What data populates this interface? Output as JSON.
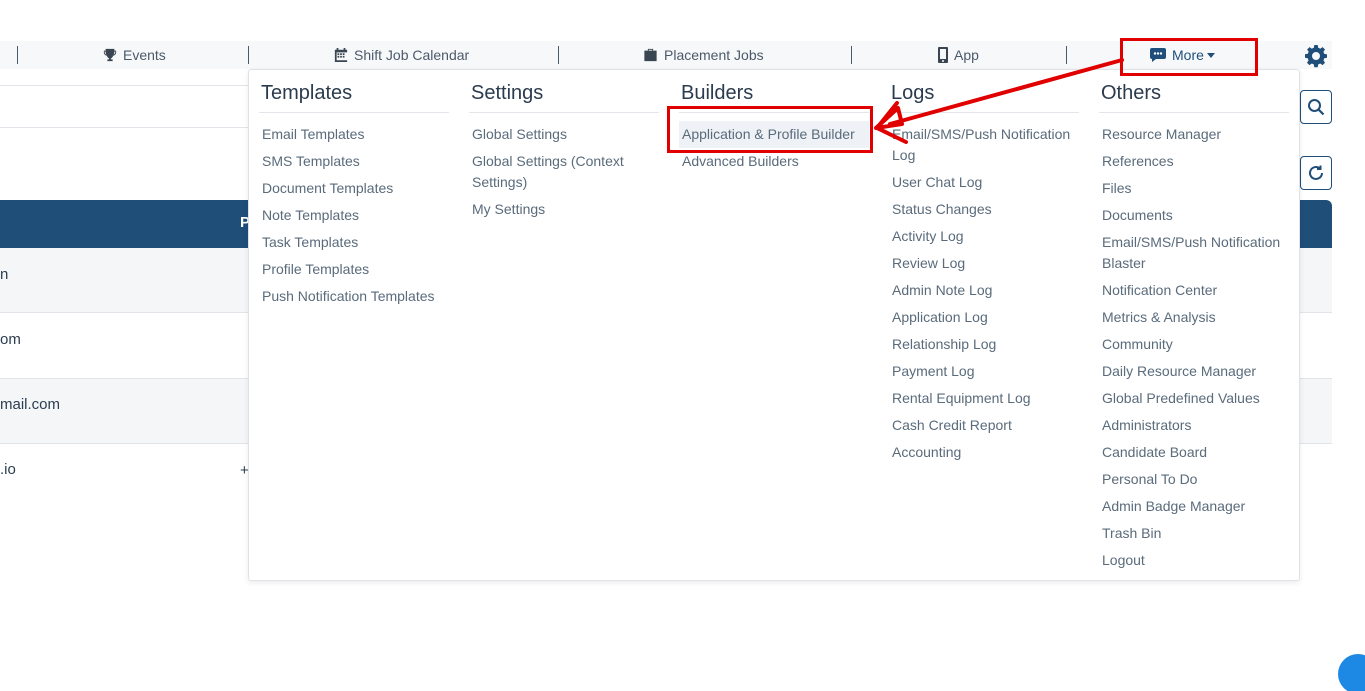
{
  "nav": {
    "items": [
      {
        "label": "Events",
        "icon": "trophy-icon"
      },
      {
        "label": "Shift Job Calendar",
        "icon": "calendar-icon"
      },
      {
        "label": "Placement Jobs",
        "icon": "briefcase-icon"
      },
      {
        "label": "App",
        "icon": "mobile-icon"
      },
      {
        "label": "More",
        "icon": "chat-dots-icon"
      }
    ],
    "settings_icon": "gear-icon"
  },
  "dropdown": {
    "columns": [
      {
        "title": "Templates",
        "items": [
          "Email Templates",
          "SMS Templates",
          "Document Templates",
          "Note Templates",
          "Task Templates",
          "Profile Templates",
          "Push Notification Templates"
        ]
      },
      {
        "title": "Settings",
        "items": [
          "Global Settings",
          "Global Settings (Context Settings)",
          "My Settings"
        ]
      },
      {
        "title": "Builders",
        "items": [
          "Application & Profile Builder",
          "Advanced Builders"
        ]
      },
      {
        "title": "Logs",
        "items": [
          "Email/SMS/Push Notification Log",
          "User Chat Log",
          "Status Changes",
          "Activity Log",
          "Review Log",
          "Admin Note Log",
          "Application Log",
          "Relationship Log",
          "Payment Log",
          "Rental Equipment Log",
          "Cash Credit Report",
          "Accounting"
        ]
      },
      {
        "title": "Others",
        "items": [
          "Resource Manager",
          "References",
          "Files",
          "Documents",
          "Email/SMS/Push Notification Blaster",
          "Notification Center",
          "Metrics & Analysis",
          "Community",
          "Daily Resource Manager",
          "Global Predefined Values",
          "Administrators",
          "Candidate Board",
          "Personal To Do",
          "Admin Badge Manager",
          "Trash Bin",
          "Logout"
        ]
      }
    ]
  },
  "background": {
    "table_header_fragment": "P",
    "rows": [
      "n",
      "om",
      "mail.com",
      ".io"
    ],
    "plus_fragment": "+"
  },
  "colors": {
    "brand": "#1f4e79",
    "annotation": "#e00000"
  }
}
